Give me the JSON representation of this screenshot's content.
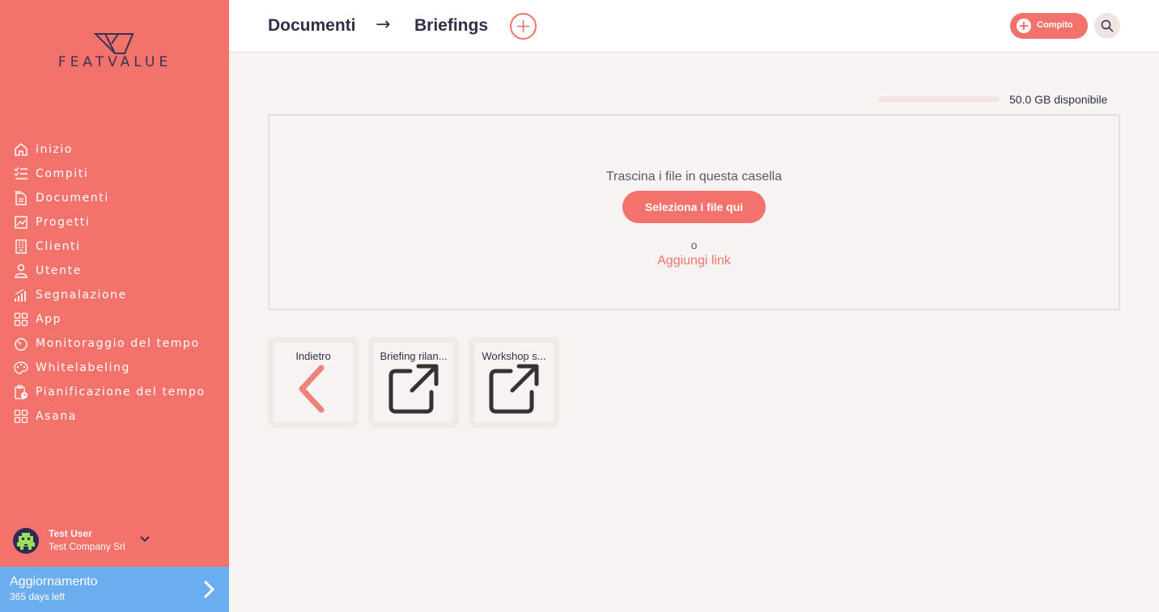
{
  "app": {
    "logo_text": "FEATVALUE"
  },
  "sidebar": {
    "items": [
      {
        "label": "inizio",
        "icon": "home-icon"
      },
      {
        "label": "Compiti",
        "icon": "tasks-icon"
      },
      {
        "label": "Documenti",
        "icon": "documents-icon"
      },
      {
        "label": "Progetti",
        "icon": "projects-icon"
      },
      {
        "label": "Clienti",
        "icon": "clients-icon"
      },
      {
        "label": "Utente",
        "icon": "user-icon"
      },
      {
        "label": "Segnalazione",
        "icon": "reporting-icon"
      },
      {
        "label": "App",
        "icon": "apps-icon"
      },
      {
        "label": "Monitoraggio del tempo",
        "icon": "timer-icon"
      },
      {
        "label": "Whitelabeling",
        "icon": "palette-icon"
      },
      {
        "label": "Pianificazione del tempo",
        "icon": "schedule-icon"
      },
      {
        "label": "Asana",
        "icon": "apps-icon"
      }
    ],
    "user": {
      "name": "Test User",
      "company": "Test Company Srl"
    },
    "upgrade": {
      "title": "Aggiornamento",
      "subtitle": "365 days left"
    }
  },
  "header": {
    "breadcrumb": [
      "Documenti",
      "Briefings"
    ],
    "breadcrumb_separator": "→",
    "task_button_label": "Compito"
  },
  "storage": {
    "text": "50.0 GB disponibile",
    "used_fraction": 0
  },
  "dropzone": {
    "instruction": "Trascina i file in questa casella",
    "select_button": "Seleziona i file qui",
    "or_text": "o",
    "add_link": "Aggiungi link"
  },
  "tiles": [
    {
      "label": "Indietro",
      "icon": "chevron-left-icon"
    },
    {
      "label": "Briefing rilan...",
      "icon": "external-link-icon"
    },
    {
      "label": "Workshop s...",
      "icon": "external-link-icon"
    }
  ],
  "colors": {
    "accent": "#f3726b",
    "upgrade": "#6aaef0",
    "text_dark": "#2e3047"
  }
}
